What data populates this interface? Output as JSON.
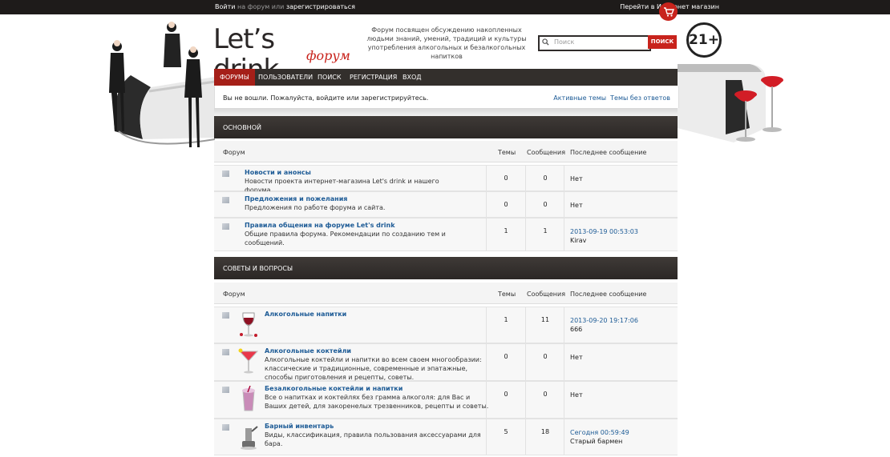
{
  "topbar": {
    "login": "Войти",
    "mid": " на форум или ",
    "register": "зарегистрироваться",
    "shop": "Перейти в Интернет магазин"
  },
  "header": {
    "logo_main": "Let’s drink...",
    "logo_sub": "форум",
    "tagline": "Форум посвящен обсуждению накопленных людьми знаний, умений, традиций и культуры употребления алкогольных и безалкогольных напитков",
    "search_placeholder": "Поиск",
    "search_button": "ПОИСК",
    "age": "21+"
  },
  "nav": [
    "ФОРУМЫ",
    "ПОЛЬЗОВАТЕЛИ",
    "ПОИСК",
    "РЕГИСТРАЦИЯ",
    "ВХОД"
  ],
  "notice": {
    "message": "Вы не вошли. Пожалуйста, войдите или зарегистрируйтесь.",
    "active": "Активные темы",
    "unanswered": "Темы без ответов"
  },
  "columns": {
    "forum": "Форум",
    "topics": "Темы",
    "posts": "Сообщения",
    "last": "Последнее сообщение"
  },
  "sections": [
    {
      "name": "ОСНОВНОЙ",
      "forums": [
        {
          "title": "Новости и анонсы",
          "desc": "Новости проекта интернет-магазина Let's drink и нашего форума.",
          "topics": "0",
          "posts": "0",
          "last_date": "",
          "last_text": "Нет"
        },
        {
          "title": "Предложения и пожелания",
          "desc": "Предложения по работе форума и сайта.",
          "topics": "0",
          "posts": "0",
          "last_date": "",
          "last_text": "Нет"
        },
        {
          "title": "Правила общения на форуме Let's drink",
          "desc": "Общие правила форума. Рекомендации по созданию тем и сообщений.",
          "topics": "1",
          "posts": "1",
          "last_date": "2013-09-19 00:53:03",
          "last_text": "Kirav"
        }
      ]
    },
    {
      "name": "СОВЕТЫ И ВОПРОСЫ",
      "forums": [
        {
          "title": "Алкогольные напитки",
          "desc": "",
          "topics": "1",
          "posts": "11",
          "last_date": "2013-09-20 19:17:06",
          "last_text": "666"
        },
        {
          "title": "Алкогольные коктейли",
          "desc": "Алкогольные коктейли и напитки во всем своем многообразии: классические и традиционные, современные и эпатажные, способы приготовления и рецепты, советы.",
          "topics": "0",
          "posts": "0",
          "last_date": "",
          "last_text": "Нет"
        },
        {
          "title": "Безалкогольные коктейли и напитки",
          "desc": "Все о напитках и коктейлях без грамма алкоголя: для Вас и Ваших детей, для закоренелых трезвенников, рецепты и советы.",
          "topics": "0",
          "posts": "0",
          "last_date": "",
          "last_text": "Нет"
        },
        {
          "title": "Барный инвентарь",
          "desc": "Виды, классификация, правила пользования аксессуарами для бара.",
          "topics": "5",
          "posts": "18",
          "last_date": "Сегодня 00:59:49",
          "last_text": "Старый бармен"
        }
      ]
    }
  ],
  "colors": {
    "accent": "#c8231c",
    "nav": "#332f2c",
    "link": "#1d5b96"
  }
}
